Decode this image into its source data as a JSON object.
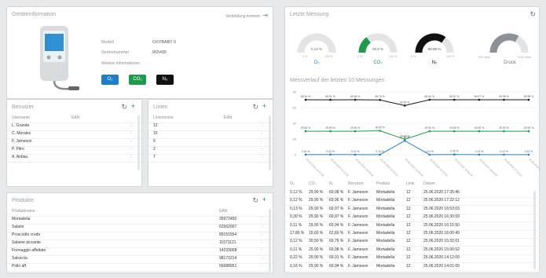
{
  "device": {
    "title": "Geräteinformation",
    "link": "Verbindung trennen",
    "model_label": "Modell",
    "model_value": "OXYBABY 6",
    "serial_label": "Seriennummer",
    "serial_value": "955495",
    "more_info": "Weitere Informationen",
    "gas_buttons": [
      {
        "label": "O₂",
        "color": "#1e7fc9"
      },
      {
        "label": "CO₂",
        "color": "#1f9a4b"
      },
      {
        "label": "N₂",
        "color": "#111111"
      }
    ]
  },
  "users": {
    "title": "Benutzer",
    "col1": "Username",
    "col2": "EAN",
    "rows": [
      "L. Grande",
      "C. Morales",
      "F. Jameson",
      "P. Pitro",
      "A. Anbau"
    ]
  },
  "lines": {
    "title": "Linien",
    "col1": "Liniennnme",
    "col2": "EAN",
    "rows": [
      "12",
      "15",
      "9",
      "2",
      "7"
    ]
  },
  "products": {
    "title": "Produkte",
    "col1": "Produktname",
    "col2": "EAN",
    "rows": [
      {
        "name": "Mortadella",
        "ean": "35972450"
      },
      {
        "name": "Salami",
        "ean": "62562007"
      },
      {
        "name": "Prosciutto crudo",
        "ean": "89151554"
      },
      {
        "name": "Salame piccante",
        "ean": "11571121"
      },
      {
        "name": "Formaggio affettato",
        "ean": "14233008"
      },
      {
        "name": "Salsiccia",
        "ean": "98171214"
      },
      {
        "name": "Pollo aff.",
        "ean": "56688951"
      }
    ]
  },
  "last": {
    "title": "Letzte Messung",
    "gauges": [
      {
        "label": "O₂",
        "value": "0,12 %",
        "min": "0 %",
        "max": "100 %",
        "fraction": 0.0012,
        "color": "#1e7fc9"
      },
      {
        "label": "CO₂",
        "value": "29,9 %",
        "min": "0 %",
        "max": "100 %",
        "fraction": 0.299,
        "color": "#1f9a4b"
      },
      {
        "label": "N₂",
        "value": "69,98 %",
        "min": "0 %",
        "max": "100 %",
        "fraction": 0.6998,
        "color": "#111111"
      },
      {
        "label": "Druck",
        "value": "900 mbar",
        "min": "500 mbar",
        "max": "1100 mbar",
        "fraction": 0.6667,
        "color": "#8d9196"
      }
    ]
  },
  "history": {
    "title": "Messverlauf der letzten 10 Messungen",
    "chart_data": {
      "type": "line",
      "x": [
        "25.06.2020 14:01:09",
        "25.06.2020 14:12:09",
        "25.06.2020 15:00:52",
        "25.06.2020 15:32:01",
        "25.06.2020 16:00:49",
        "25.06.2020 16:15:50",
        "25.06.2020 16:30:09",
        "25.06.2020 16:53:03",
        "25.06.2020 17:22:12",
        "25.06.2020 17:35:46"
      ],
      "series": [
        {
          "values": [
            69.94,
            69.91,
            69.98,
            69.76,
            62.6,
            69.94,
            69.97,
            69.97,
            69.96,
            69.98
          ],
          "color": "#111111"
        },
        {
          "values": [
            29.9,
            29.9,
            29.9,
            30.5,
            19.6,
            29.9,
            29.9,
            29.9,
            29.9,
            29.9
          ],
          "color": "#1f9a4b"
        },
        {
          "values": [
            0.16,
            0.22,
            0.11,
            0.12,
            17.8,
            0.11,
            0.3,
            0.13,
            0.12,
            0.12
          ],
          "color": "#1e7fc9"
        }
      ],
      "y_ticks": [
        "80",
        "60",
        "40",
        "20",
        "0"
      ],
      "ylim": [
        0,
        80
      ],
      "point_labels": [
        [
          "69.94 %",
          "69.91 %",
          "69.98 %",
          "69.76 %",
          "62.60 %",
          "69.94 %",
          "69.97 %",
          "69.97 %",
          "69.96 %",
          "69.98 %"
        ],
        [
          "29.90 %",
          "29.90 %",
          "29.90 %",
          "30.50 %",
          "19.60 %",
          "29.90 %",
          "29.90 %",
          "29.90 %",
          "29.90 %",
          "29.90 %"
        ],
        [
          "0.16 %",
          "0.22 %",
          "0.11 %",
          "0.12 %",
          "17.80 %",
          "0.11 %",
          "0.30 %",
          "0.13 %",
          "0.12 %",
          "0.12 %"
        ]
      ]
    },
    "table": {
      "headers": [
        "O₂",
        "CO₂",
        "N₂",
        "Benutzer",
        "Produkt",
        "Linie",
        "Datum"
      ],
      "rows": [
        [
          "0,12 %",
          "29,90 %",
          "69,98 %",
          "F. Jameson",
          "Mortadella",
          "12",
          "25.06.2020 17:35:46"
        ],
        [
          "0,12 %",
          "29,90 %",
          "69,96 %",
          "F. Jameson",
          "Mortadella",
          "12",
          "25.06.2020 17:22:12"
        ],
        [
          "0,13 %",
          "29,90 %",
          "69,97 %",
          "F. Jameson",
          "Mortadella",
          "12",
          "25.06.2020 16:53:03"
        ],
        [
          "0,30 %",
          "29,90 %",
          "69,97 %",
          "F. Jameson",
          "Mortadella",
          "12",
          "25.06.2020 16:30:09"
        ],
        [
          "0,11 %",
          "29,90 %",
          "69,94 %",
          "F. Jameson",
          "Mortadella",
          "12",
          "25.06.2020 16:15:50"
        ],
        [
          "17,80 %",
          "19,60 %",
          "62,60 %",
          "F. Jameson",
          "Mortadella",
          "12",
          "25.06.2020 16:00:49"
        ],
        [
          "0,12 %",
          "30,50 %",
          "69,76 %",
          "F. Jameson",
          "Mortadella",
          "12",
          "25.06.2020 15:32:01"
        ],
        [
          "0,11 %",
          "29,90 %",
          "69,98 %",
          "F. Jameson",
          "Mortadella",
          "12",
          "25.06.2020 15:00:52"
        ],
        [
          "0,22 %",
          "29,90 %",
          "69,91 %",
          "F. Jameson",
          "Mortadella",
          "12",
          "25.06.2020 14:12:09"
        ],
        [
          "0,16 %",
          "29,90 %",
          "69,94 %",
          "F. Jameson",
          "Mortadella",
          "12",
          "25.06.2020 14:01:09"
        ]
      ]
    }
  }
}
